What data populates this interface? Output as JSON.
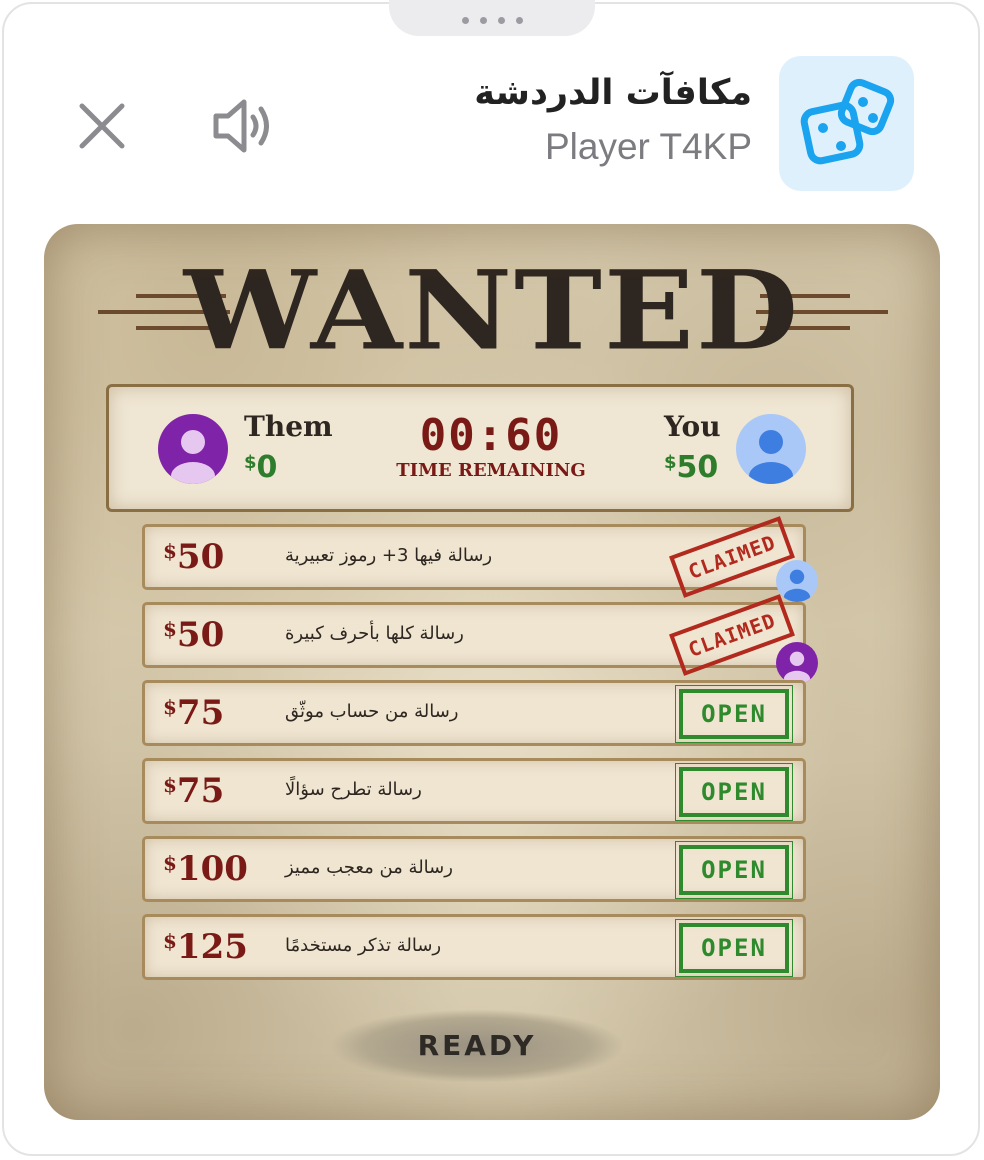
{
  "header": {
    "title": "مكافآت الدردشة",
    "subtitle": "Player T4KP",
    "icons": {
      "close": "close-icon",
      "sound": "speaker-icon",
      "app": "dice-icon"
    },
    "accent_color": "#1aa3ee"
  },
  "poster": {
    "heading": "WANTED",
    "them": {
      "name": "Them",
      "money": "0",
      "currency": "$"
    },
    "you": {
      "name": "You",
      "money": "50",
      "currency": "$"
    },
    "timer": "00:60",
    "timer_label": "TIME REMAINING",
    "ready_label": "READY"
  },
  "bounties": [
    {
      "amount": "50",
      "currency": "$",
      "description": "رسالة فيها 3+ رموز تعبيرية",
      "status": "CLAIMED",
      "claimed_by": "you"
    },
    {
      "amount": "50",
      "currency": "$",
      "description": "رسالة كلها بأحرف كبيرة",
      "status": "CLAIMED",
      "claimed_by": "them"
    },
    {
      "amount": "75",
      "currency": "$",
      "description": "رسالة من حساب موثّق",
      "status": "OPEN"
    },
    {
      "amount": "75",
      "currency": "$",
      "description": "رسالة تطرح سؤالًا",
      "status": "OPEN"
    },
    {
      "amount": "100",
      "currency": "$",
      "description": "رسالة من معجب مميز",
      "status": "OPEN"
    },
    {
      "amount": "125",
      "currency": "$",
      "description": "رسالة تذكر مستخدمًا",
      "status": "OPEN"
    }
  ]
}
